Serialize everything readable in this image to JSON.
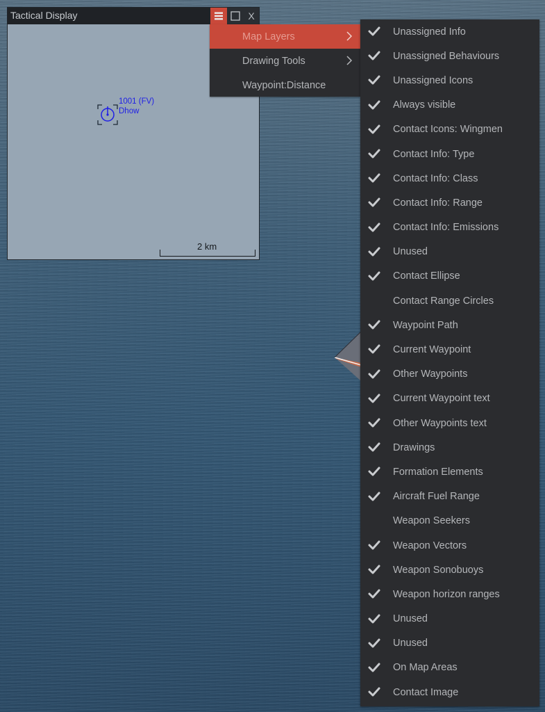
{
  "window": {
    "title": "Tactical Display",
    "buttons": {
      "menu_icon": "hamburger-menu-icon",
      "maximize_icon": "maximize-icon",
      "close_label": "X"
    }
  },
  "map": {
    "background_color": "#97a6b4",
    "contact": {
      "id_label": "1001 (FV)",
      "type_label": "Dhow",
      "color": "#1f1fe6"
    },
    "scale": {
      "label": "2 km"
    }
  },
  "menu": {
    "items": [
      {
        "label": "Map Layers",
        "has_submenu": true,
        "active": true
      },
      {
        "label": "Drawing Tools",
        "has_submenu": true,
        "active": false
      },
      {
        "label": "Waypoint:Distance",
        "has_submenu": false,
        "active": false
      }
    ],
    "accent_color": "#c8493a"
  },
  "submenu": {
    "items": [
      {
        "label": "Unassigned Info",
        "checked": true
      },
      {
        "label": "Unassigned Behaviours",
        "checked": true
      },
      {
        "label": "Unassigned Icons",
        "checked": true
      },
      {
        "label": "Always visible",
        "checked": true
      },
      {
        "label": "Contact Icons: Wingmen",
        "checked": true
      },
      {
        "label": "Contact Info: Type",
        "checked": true
      },
      {
        "label": "Contact Info: Class",
        "checked": true
      },
      {
        "label": "Contact Info: Range",
        "checked": true
      },
      {
        "label": "Contact Info: Emissions",
        "checked": true
      },
      {
        "label": "Unused",
        "checked": true
      },
      {
        "label": "Contact Ellipse",
        "checked": true
      },
      {
        "label": "Contact Range Circles",
        "checked": false
      },
      {
        "label": "Waypoint Path",
        "checked": true
      },
      {
        "label": "Current Waypoint",
        "checked": true
      },
      {
        "label": "Other Waypoints",
        "checked": true
      },
      {
        "label": "Current Waypoint text",
        "checked": true
      },
      {
        "label": "Other Waypoints text",
        "checked": true
      },
      {
        "label": "Drawings",
        "checked": true
      },
      {
        "label": "Formation Elements",
        "checked": true
      },
      {
        "label": "Aircraft Fuel Range",
        "checked": true
      },
      {
        "label": "Weapon Seekers",
        "checked": false
      },
      {
        "label": "Weapon Vectors",
        "checked": true
      },
      {
        "label": "Weapon Sonobuoys",
        "checked": true
      },
      {
        "label": "Weapon horizon ranges",
        "checked": true
      },
      {
        "label": "Unused",
        "checked": true
      },
      {
        "label": "Unused",
        "checked": true
      },
      {
        "label": "On Map Areas",
        "checked": true
      },
      {
        "label": "Contact Image",
        "checked": true
      }
    ]
  }
}
